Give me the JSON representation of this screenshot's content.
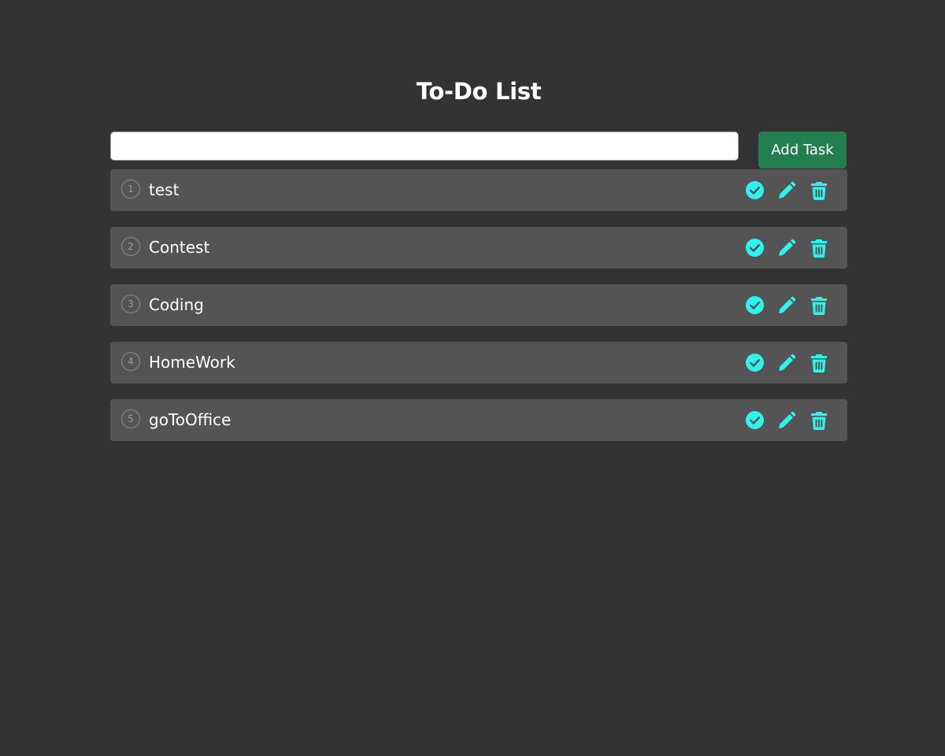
{
  "header": {
    "title": "To-Do List"
  },
  "input": {
    "value": "",
    "placeholder": ""
  },
  "add_button": {
    "label": "Add Task"
  },
  "tasks": [
    {
      "number": "1",
      "text": "test"
    },
    {
      "number": "2",
      "text": "Contest"
    },
    {
      "number": "3",
      "text": "Coding"
    },
    {
      "number": "4",
      "text": "HomeWork"
    },
    {
      "number": "5",
      "text": "goToOffice"
    }
  ],
  "icons": {
    "complete": "check-circle-icon",
    "edit": "pencil-icon",
    "delete": "trash-icon"
  },
  "colors": {
    "background": "#333333",
    "task_background": "#545454",
    "accent": "#2ef2ee",
    "add_button": "#22804e"
  }
}
